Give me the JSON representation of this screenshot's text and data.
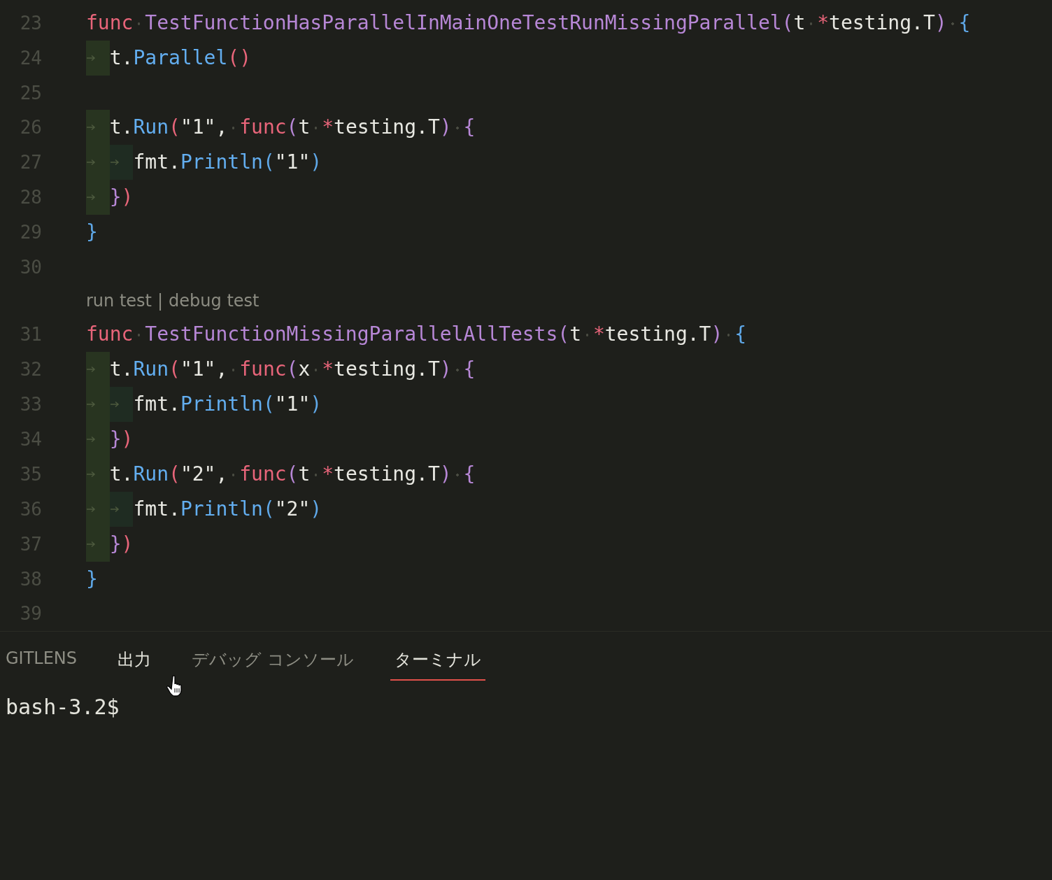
{
  "editor": {
    "lines": [
      {
        "number": "23",
        "tokens": [
          {
            "kind": "keyword",
            "text": "func"
          },
          {
            "kind": "space"
          },
          {
            "kind": "function",
            "text": "TestFunctionHasParallelInMainOneTestRunMissingParallel"
          },
          {
            "kind": "bracket2",
            "text": "("
          },
          {
            "kind": "plain",
            "text": "t"
          },
          {
            "kind": "space"
          },
          {
            "kind": "operator",
            "text": "*"
          },
          {
            "kind": "plain",
            "text": "testing.T"
          },
          {
            "kind": "bracket2",
            "text": ")"
          },
          {
            "kind": "space"
          },
          {
            "kind": "bracket1",
            "text": "{"
          }
        ]
      },
      {
        "number": "24",
        "tokens": [
          {
            "kind": "tab"
          },
          {
            "kind": "plain",
            "text": "t."
          },
          {
            "kind": "method",
            "text": "Parallel"
          },
          {
            "kind": "bracket3",
            "text": "()"
          }
        ]
      },
      {
        "number": "25"
      },
      {
        "number": "26",
        "tokens": [
          {
            "kind": "tab"
          },
          {
            "kind": "plain",
            "text": "t."
          },
          {
            "kind": "method",
            "text": "Run"
          },
          {
            "kind": "bracket3",
            "text": "("
          },
          {
            "kind": "plain",
            "text": "\"1\","
          },
          {
            "kind": "space"
          },
          {
            "kind": "keyword",
            "text": "func"
          },
          {
            "kind": "bracket2",
            "text": "("
          },
          {
            "kind": "plain",
            "text": "t"
          },
          {
            "kind": "space"
          },
          {
            "kind": "operator",
            "text": "*"
          },
          {
            "kind": "plain",
            "text": "testing.T"
          },
          {
            "kind": "bracket2",
            "text": ")"
          },
          {
            "kind": "space"
          },
          {
            "kind": "bracket2",
            "text": "{"
          }
        ]
      },
      {
        "number": "27",
        "tokens": [
          {
            "kind": "tab"
          },
          {
            "kind": "tab"
          },
          {
            "kind": "plain",
            "text": "fmt."
          },
          {
            "kind": "method",
            "text": "Println"
          },
          {
            "kind": "bracket1",
            "text": "("
          },
          {
            "kind": "plain",
            "text": "\"1\""
          },
          {
            "kind": "bracket1",
            "text": ")"
          }
        ]
      },
      {
        "number": "28",
        "tokens": [
          {
            "kind": "tab"
          },
          {
            "kind": "bracket2",
            "text": "}"
          },
          {
            "kind": "bracket3",
            "text": ")"
          }
        ]
      },
      {
        "number": "29",
        "tokens": [
          {
            "kind": "bracket1",
            "text": "}"
          }
        ]
      },
      {
        "number": "30"
      },
      {
        "lens": [
          "run test",
          "|",
          "debug test"
        ],
        "number": "31",
        "tokens": [
          {
            "kind": "keyword",
            "text": "func"
          },
          {
            "kind": "space"
          },
          {
            "kind": "function",
            "text": "TestFunctionMissingParallelAllTests"
          },
          {
            "kind": "bracket2",
            "text": "("
          },
          {
            "kind": "plain",
            "text": "t"
          },
          {
            "kind": "space"
          },
          {
            "kind": "operator",
            "text": "*"
          },
          {
            "kind": "plain",
            "text": "testing.T"
          },
          {
            "kind": "bracket2",
            "text": ")"
          },
          {
            "kind": "space"
          },
          {
            "kind": "bracket1",
            "text": "{"
          }
        ]
      },
      {
        "number": "32",
        "tokens": [
          {
            "kind": "tab"
          },
          {
            "kind": "plain",
            "text": "t."
          },
          {
            "kind": "method",
            "text": "Run"
          },
          {
            "kind": "bracket3",
            "text": "("
          },
          {
            "kind": "plain",
            "text": "\"1\","
          },
          {
            "kind": "space"
          },
          {
            "kind": "keyword",
            "text": "func"
          },
          {
            "kind": "bracket2",
            "text": "("
          },
          {
            "kind": "plain",
            "text": "x"
          },
          {
            "kind": "space"
          },
          {
            "kind": "operator",
            "text": "*"
          },
          {
            "kind": "plain",
            "text": "testing.T"
          },
          {
            "kind": "bracket2",
            "text": ")"
          },
          {
            "kind": "space"
          },
          {
            "kind": "bracket2",
            "text": "{"
          }
        ]
      },
      {
        "number": "33",
        "tokens": [
          {
            "kind": "tab"
          },
          {
            "kind": "tab"
          },
          {
            "kind": "plain",
            "text": "fmt."
          },
          {
            "kind": "method",
            "text": "Println"
          },
          {
            "kind": "bracket1",
            "text": "("
          },
          {
            "kind": "plain",
            "text": "\"1\""
          },
          {
            "kind": "bracket1",
            "text": ")"
          }
        ]
      },
      {
        "number": "34",
        "tokens": [
          {
            "kind": "tab"
          },
          {
            "kind": "bracket2",
            "text": "}"
          },
          {
            "kind": "bracket3",
            "text": ")"
          }
        ]
      },
      {
        "number": "35",
        "tokens": [
          {
            "kind": "tab"
          },
          {
            "kind": "plain",
            "text": "t."
          },
          {
            "kind": "method",
            "text": "Run"
          },
          {
            "kind": "bracket3",
            "text": "("
          },
          {
            "kind": "plain",
            "text": "\"2\","
          },
          {
            "kind": "space"
          },
          {
            "kind": "keyword",
            "text": "func"
          },
          {
            "kind": "bracket2",
            "text": "("
          },
          {
            "kind": "plain",
            "text": "t"
          },
          {
            "kind": "space"
          },
          {
            "kind": "operator",
            "text": "*"
          },
          {
            "kind": "plain",
            "text": "testing.T"
          },
          {
            "kind": "bracket2",
            "text": ")"
          },
          {
            "kind": "space"
          },
          {
            "kind": "bracket2",
            "text": "{"
          }
        ]
      },
      {
        "number": "36",
        "tokens": [
          {
            "kind": "tab"
          },
          {
            "kind": "tab"
          },
          {
            "kind": "plain",
            "text": "fmt."
          },
          {
            "kind": "method",
            "text": "Println"
          },
          {
            "kind": "bracket1",
            "text": "("
          },
          {
            "kind": "plain",
            "text": "\"2\""
          },
          {
            "kind": "bracket1",
            "text": ")"
          }
        ]
      },
      {
        "number": "37",
        "tokens": [
          {
            "kind": "tab"
          },
          {
            "kind": "bracket2",
            "text": "}"
          },
          {
            "kind": "bracket3",
            "text": ")"
          }
        ]
      },
      {
        "number": "38",
        "tokens": [
          {
            "kind": "bracket1",
            "text": "}"
          }
        ]
      },
      {
        "number": "39"
      }
    ]
  },
  "panel": {
    "tabs": [
      {
        "label": "GITLENS",
        "selected": false,
        "hovered": false
      },
      {
        "label": "出力",
        "selected": false,
        "hovered": true
      },
      {
        "label": "デバッグ コンソール",
        "selected": false,
        "hovered": false
      },
      {
        "label": "ターミナル",
        "selected": true,
        "hovered": false
      }
    ],
    "terminal": {
      "prompt": "bash-3.2$"
    }
  }
}
